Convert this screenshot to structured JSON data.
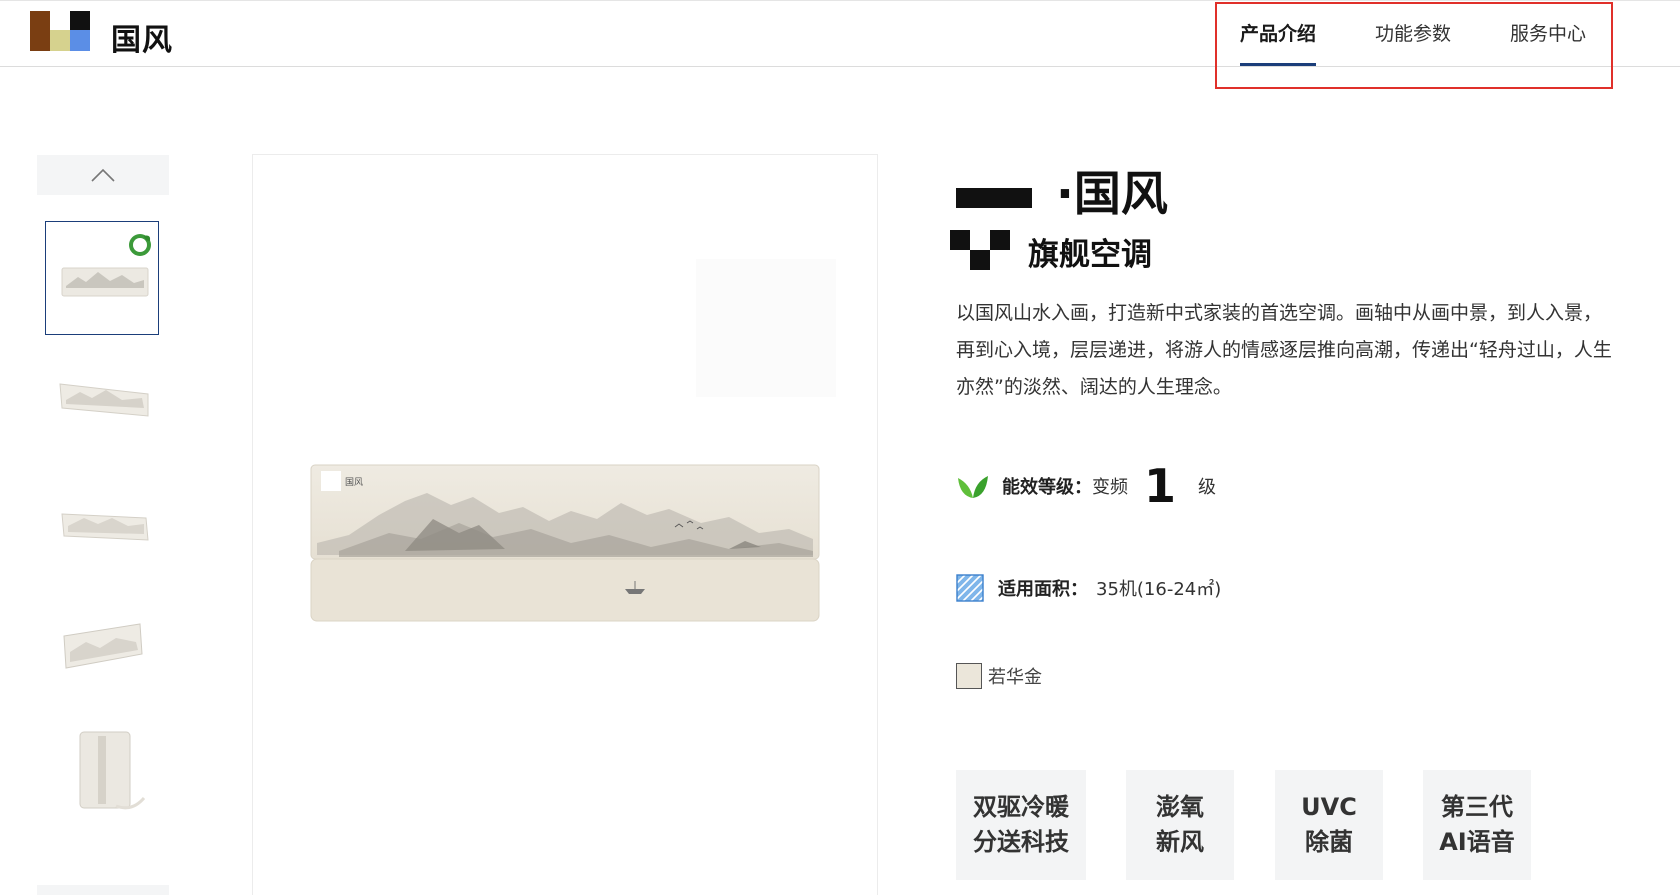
{
  "header": {
    "brand": "国风",
    "logo_colors": [
      "#7a3e12",
      "#d6d28e",
      "#111111",
      "#5b8ee6"
    ],
    "nav": [
      {
        "label": "产品介绍",
        "active": true
      },
      {
        "label": "功能参数",
        "active": false
      },
      {
        "label": "服务中心",
        "active": false
      }
    ],
    "accent_color": "#1b3e7a",
    "highlight_color": "#e0302a"
  },
  "gallery": {
    "thumbnails": [
      "ac-front-badge",
      "ac-angle-left",
      "ac-angle-right",
      "ac-side",
      "ac-bottom"
    ],
    "selected_index": 0,
    "up_icon": "chevron-up-icon"
  },
  "product": {
    "title_suffix": "·国风",
    "subtitle": "旗舰空调",
    "description": "以国风山水入画，打造新中式家装的首选空调。画轴中从画中景，到人入景，再到心入境，层层递进，将游人的情感逐层推向高潮，传递出“轻舟过山，人生亦然”的淡然、阔达的人生理念。",
    "energy": {
      "icon": "leaf-icon",
      "label": "能效等级：",
      "type": "变频",
      "grade": "1",
      "unit": "级"
    },
    "area": {
      "icon": "area-icon",
      "label": "适用面积：",
      "value": "35机(16-24㎡)"
    },
    "color_option": {
      "name": "若华金",
      "swatch": "#ebe6da"
    },
    "features": [
      {
        "line1": "双驱冷暖",
        "line2": "分送科技"
      },
      {
        "line1": "澎氧",
        "line2": "新风"
      },
      {
        "line1": "UVC",
        "line2": "除菌"
      },
      {
        "line1": "第三代",
        "line2": "AI语音"
      }
    ],
    "panel_label": "国风"
  }
}
